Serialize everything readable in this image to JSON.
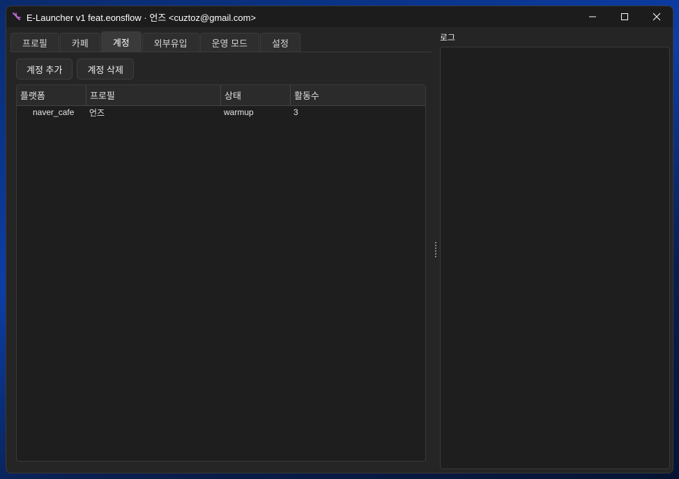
{
  "window": {
    "title": "E-Launcher v1 feat.eonsflow · 언즈 <cuztoz@gmail.com>",
    "controls": {
      "minimize_icon": "minimize-icon",
      "maximize_icon": "maximize-icon",
      "close_icon": "close-icon"
    }
  },
  "tabs": [
    {
      "label": "프로필",
      "active": false
    },
    {
      "label": "카페",
      "active": false
    },
    {
      "label": "계정",
      "active": true
    },
    {
      "label": "외부유입",
      "active": false
    },
    {
      "label": "운영 모드",
      "active": false
    },
    {
      "label": "설정",
      "active": false
    }
  ],
  "toolbar": {
    "add_label": "계정 추가",
    "delete_label": "계정 삭제"
  },
  "table": {
    "headers": [
      "플랫폼",
      "프로필",
      "상태",
      "활동수"
    ],
    "rows": [
      [
        "naver_cafe",
        "언즈",
        "warmup",
        "3"
      ]
    ]
  },
  "log": {
    "label": "로그"
  },
  "colors": {
    "accent_icon": "#c06ad6",
    "window_bg": "#252525",
    "titlebar_bg": "#1c1c1c"
  }
}
